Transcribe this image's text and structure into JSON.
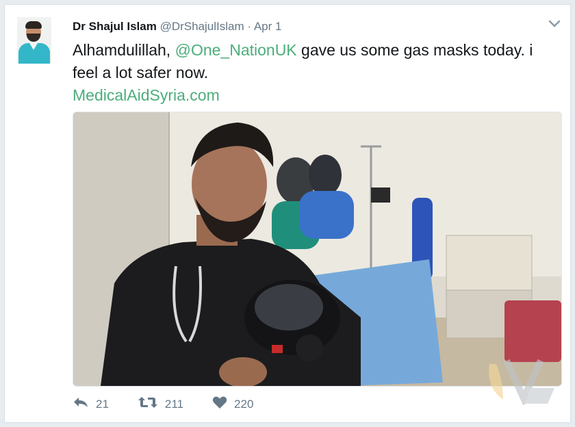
{
  "tweet": {
    "author_name": "Dr Shajul Islam",
    "handle": "@DrShajulIslam",
    "separator": "·",
    "date": "Apr 1",
    "text_part1": "Alhamdulillah, ",
    "mention": "@One_NationUK",
    "text_part2": " gave us some gas masks today. i feel a lot safer now.",
    "link": "MedicalAidSyria.com",
    "media_alt": "Photo of a man in a dark hoodie holding a gas mask in a hospital ward",
    "reply_count": "21",
    "retweet_count": "211",
    "like_count": "220"
  },
  "icons": {
    "reply": "reply-icon",
    "retweet": "retweet-icon",
    "like": "heart-icon",
    "menu": "chevron-down-icon"
  },
  "colors": {
    "link_accent": "#4dad7a",
    "text": "#14171a",
    "meta": "#657786"
  }
}
